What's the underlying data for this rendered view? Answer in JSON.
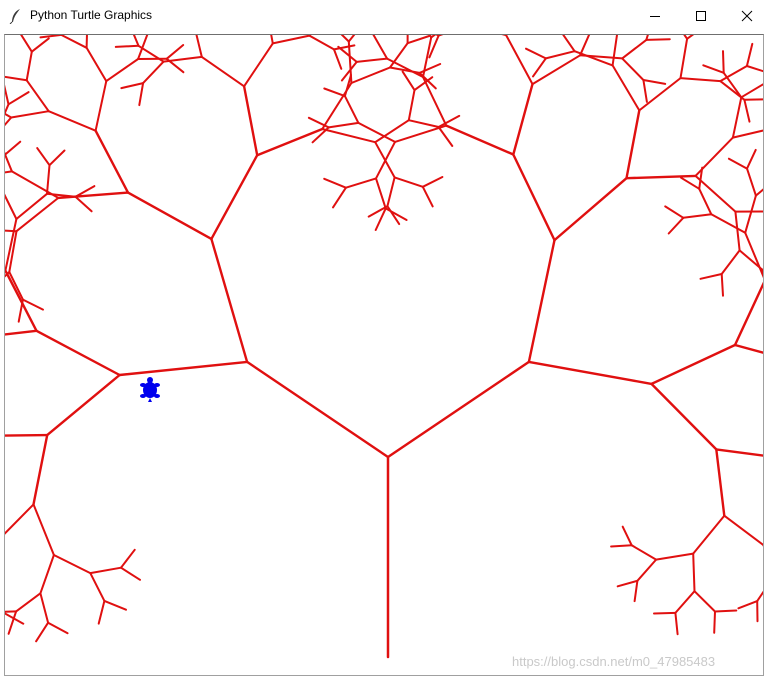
{
  "window": {
    "title": "Python Turtle Graphics",
    "controls": [
      "minimize-icon",
      "maximize-icon",
      "close-icon"
    ]
  },
  "canvas": {
    "background": "#ffffff",
    "pen_color": "#e01010",
    "turtle_color": "#0000ee",
    "turtle_shape": "turtle-icon"
  },
  "watermark": "https://blog.csdn.net/m0_47985483"
}
